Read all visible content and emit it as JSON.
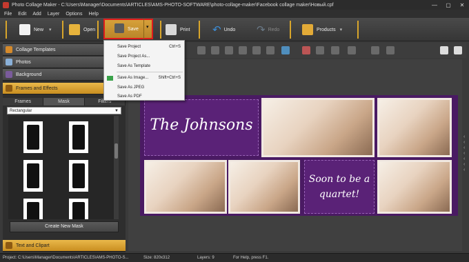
{
  "window": {
    "title": "Photo Collage Maker - C:\\Users\\Manager\\Documents\\ARTICLES\\AMS-PHOTO-SOFTWARE\\photo-collage-maker\\Facebook collage maker\\Новый.cpf",
    "controls": [
      "—",
      "▢",
      "✕"
    ]
  },
  "menu": [
    "File",
    "Edit",
    "Add",
    "Layer",
    "Options",
    "Help"
  ],
  "toolbar": {
    "new_label": "New",
    "open_label": "Open",
    "save_label": "Save",
    "print_label": "Print",
    "undo_label": "Undo",
    "redo_label": "Redo",
    "products_label": "Products"
  },
  "save_menu": {
    "items": [
      {
        "label": "Save Project",
        "shortcut": "Ctrl+S"
      },
      {
        "label": "Save Project As...",
        "shortcut": ""
      },
      {
        "label": "Save As Template",
        "shortcut": ""
      },
      {
        "label": "Save As Image...",
        "shortcut": "Shift+Ctrl+S"
      },
      {
        "label": "Save As JPEG",
        "shortcut": ""
      },
      {
        "label": "Save As PDF",
        "shortcut": ""
      }
    ]
  },
  "left_panel": {
    "sections": [
      "Collage Templates",
      "Photos",
      "Background",
      "Frames and Effects",
      "Text and Clipart"
    ],
    "subtabs": [
      "Frames",
      "Mask",
      "Filters"
    ],
    "mask_select": "Rectangular",
    "create_mask_button": "Create New Mask"
  },
  "collage": {
    "title_text": "The Johnsons",
    "caption_text": "Soon to be a quartet!"
  },
  "statusbar": {
    "project": "Project: C:\\Users\\Manager\\Documents\\ARTICLES\\AMS-PHOTO-S...",
    "size": "Size: 820x312",
    "layers": "Layers: 9",
    "help": "For Help, press F1."
  },
  "colors": {
    "accent": "#d9a62b",
    "highlight_border": "#e01b1b",
    "collage_bg": "#4a1a63"
  }
}
